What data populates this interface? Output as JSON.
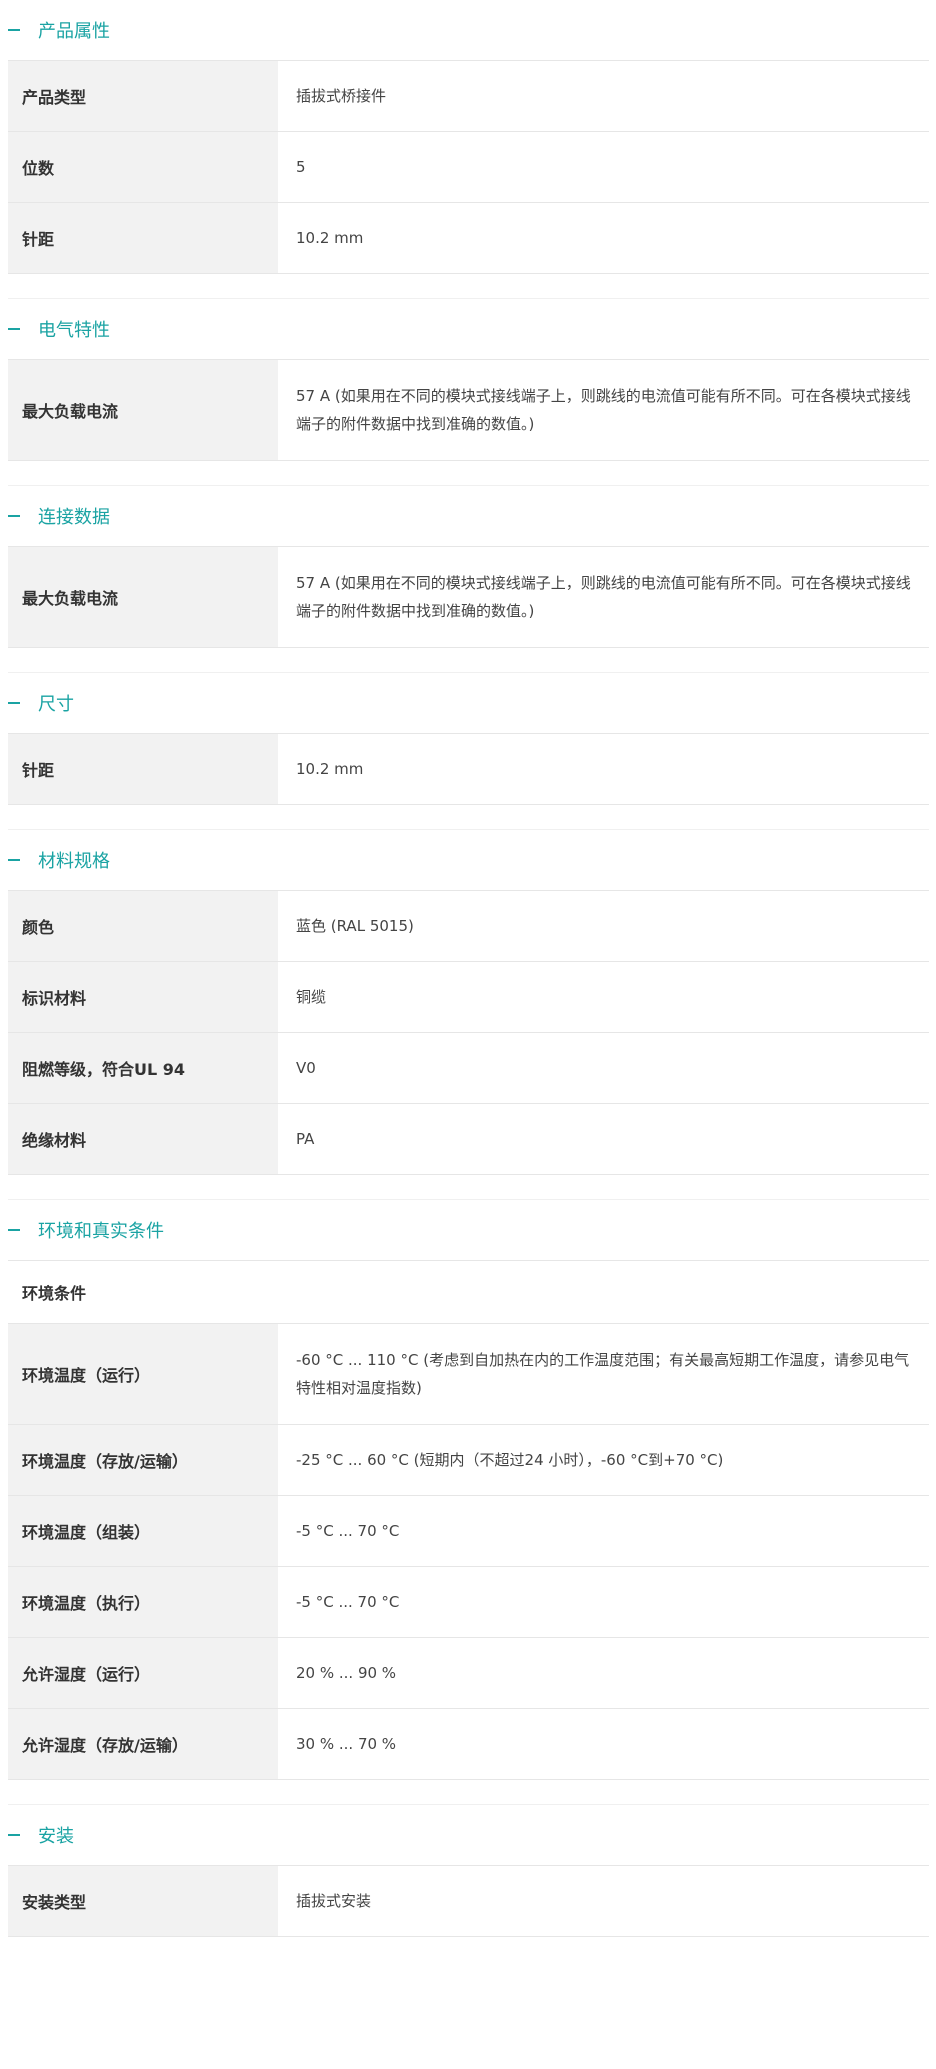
{
  "sections": [
    {
      "title": "产品属性",
      "rows": [
        {
          "label": "产品类型",
          "value": "插拔式桥接件"
        },
        {
          "label": "位数",
          "value": "5"
        },
        {
          "label": "针距",
          "value": "10.2 mm"
        }
      ]
    },
    {
      "title": "电气特性",
      "rows": [
        {
          "label": "最大负载电流",
          "value": "57 A (如果用在不同的模块式接线端子上，则跳线的电流值可能有所不同。可在各模块式接线端子的附件数据中找到准确的数值。)"
        }
      ]
    },
    {
      "title": "连接数据",
      "rows": [
        {
          "label": "最大负载电流",
          "value": "57 A (如果用在不同的模块式接线端子上，则跳线的电流值可能有所不同。可在各模块式接线端子的附件数据中找到准确的数值。)"
        }
      ]
    },
    {
      "title": "尺寸",
      "rows": [
        {
          "label": "针距",
          "value": "10.2 mm"
        }
      ]
    },
    {
      "title": "材料规格",
      "rows": [
        {
          "label": "颜色",
          "value": "蓝色 (RAL 5015)"
        },
        {
          "label": "标识材料",
          "value": "铜缆"
        },
        {
          "label": "阻燃等级，符合UL 94",
          "value": "V0"
        },
        {
          "label": "绝缘材料",
          "value": "PA"
        }
      ]
    },
    {
      "title": "环境和真实条件",
      "group": "环境条件",
      "rows": [
        {
          "label": "环境温度（运行）",
          "value": "-60 °C ... 110 °C (考虑到自加热在内的工作温度范围；有关最高短期工作温度，请参见电气特性相对温度指数)"
        },
        {
          "label": "环境温度（存放/运输）",
          "value": "-25 °C ... 60 °C (短期内（不超过24 小时），-60 °C到+70 °C)"
        },
        {
          "label": "环境温度（组装）",
          "value": "-5 °C ... 70 °C"
        },
        {
          "label": "环境温度（执行）",
          "value": "-5 °C ... 70 °C"
        },
        {
          "label": "允许湿度（运行）",
          "value": "20 % ... 90 %"
        },
        {
          "label": "允许湿度（存放/运输）",
          "value": "30 % ... 70 %"
        }
      ]
    },
    {
      "title": "安装",
      "rows": [
        {
          "label": "安装类型",
          "value": "插拔式安装"
        }
      ]
    }
  ],
  "icons": {
    "collapse": "minus-icon"
  },
  "colors": {
    "accent": "#1aa3a3",
    "label_bg": "#f2f2f2",
    "border": "#e6e6e6"
  }
}
